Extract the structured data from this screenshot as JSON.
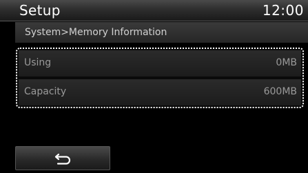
{
  "header": {
    "title": "Setup",
    "clock": "12:00"
  },
  "breadcrumb": {
    "path": "System>Memory Information"
  },
  "memory_info": {
    "rows": [
      {
        "label": "Using",
        "value": "0MB"
      },
      {
        "label": "Capacity",
        "value": "600MB"
      }
    ]
  },
  "footer": {
    "back_icon": "back-arrow-icon"
  },
  "colors": {
    "background": "#000000",
    "text": "#ffffff",
    "muted_text": "#9a9a9a"
  }
}
